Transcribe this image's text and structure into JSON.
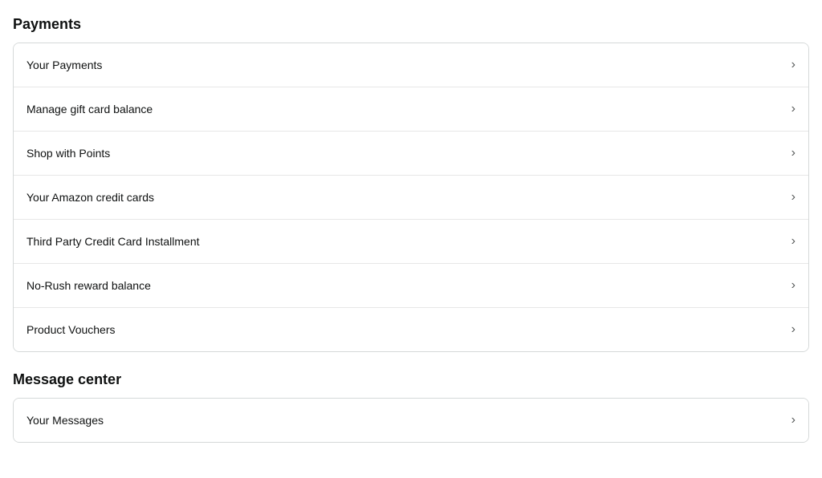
{
  "payments": {
    "section_title": "Payments",
    "items": [
      {
        "label": "Your Payments",
        "id": "your-payments"
      },
      {
        "label": "Manage gift card balance",
        "id": "manage-gift-card-balance"
      },
      {
        "label": "Shop with Points",
        "id": "shop-with-points"
      },
      {
        "label": "Your Amazon credit cards",
        "id": "your-amazon-credit-cards"
      },
      {
        "label": "Third Party Credit Card Installment",
        "id": "third-party-credit-card-installment"
      },
      {
        "label": "No-Rush reward balance",
        "id": "no-rush-reward-balance"
      },
      {
        "label": "Product Vouchers",
        "id": "product-vouchers"
      }
    ]
  },
  "message_center": {
    "section_title": "Message center",
    "items": [
      {
        "label": "Your Messages",
        "id": "your-messages"
      }
    ]
  }
}
